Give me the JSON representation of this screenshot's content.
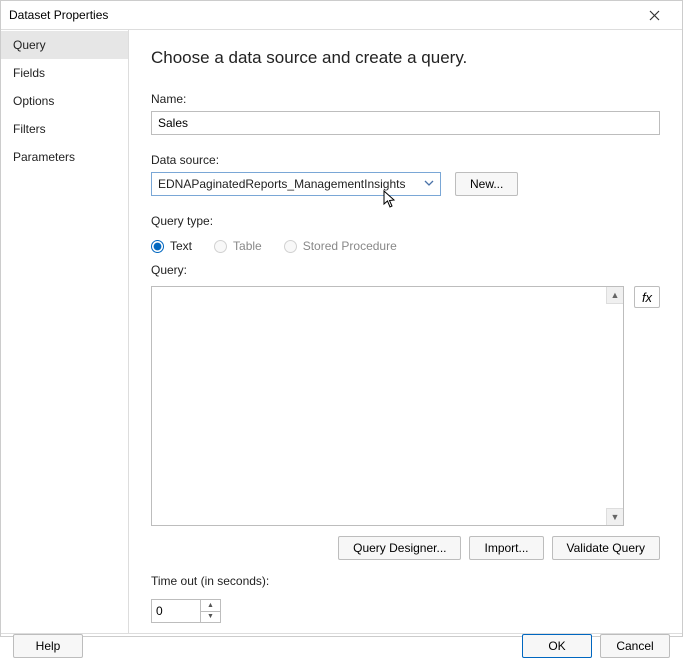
{
  "window": {
    "title": "Dataset Properties"
  },
  "sidebar": {
    "items": [
      {
        "label": "Query",
        "selected": true
      },
      {
        "label": "Fields",
        "selected": false
      },
      {
        "label": "Options",
        "selected": false
      },
      {
        "label": "Filters",
        "selected": false
      },
      {
        "label": "Parameters",
        "selected": false
      }
    ]
  },
  "main": {
    "heading": "Choose a data source and create a query.",
    "name_label": "Name:",
    "name_value": "Sales",
    "data_source_label": "Data source:",
    "data_source_value": "EDNAPaginatedReports_ManagementInsights",
    "new_button": "New...",
    "query_type_label": "Query type:",
    "query_type_options": [
      {
        "label": "Text",
        "value": "text",
        "enabled": true
      },
      {
        "label": "Table",
        "value": "table",
        "enabled": false
      },
      {
        "label": "Stored Procedure",
        "value": "sp",
        "enabled": false
      }
    ],
    "query_type_selected": "text",
    "query_label": "Query:",
    "query_value": "",
    "fx_label": "fx",
    "query_designer_button": "Query Designer...",
    "import_button": "Import...",
    "validate_button": "Validate Query",
    "timeout_label": "Time out (in seconds):",
    "timeout_value": "0"
  },
  "footer": {
    "help": "Help",
    "ok": "OK",
    "cancel": "Cancel"
  }
}
